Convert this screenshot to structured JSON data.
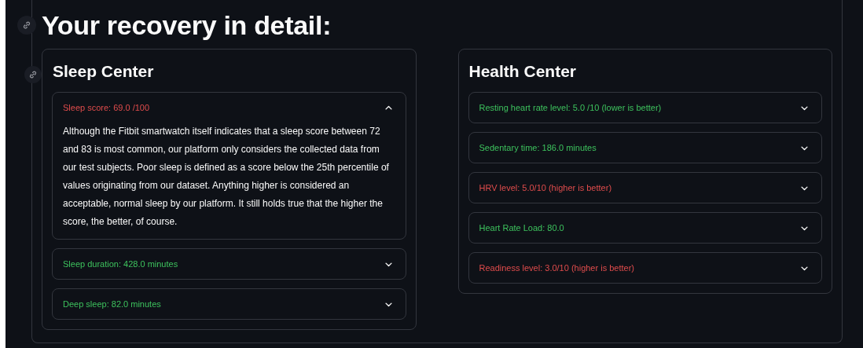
{
  "heading": "Your recovery in detail:",
  "cards": [
    {
      "title": "Sleep Center",
      "expanders": [
        {
          "label": "Sleep score: 69.0 /100",
          "color": "#e04c4c",
          "expanded": true,
          "body": "Although the Fitbit smartwatch itself indicates that a sleep score between 72 and 83 is most common, our platform only considers the collected data from our test subjects. Poor sleep is defined as a score below the 25th percentile of values originating from our dataset. Anything higher is considered an acceptable, normal sleep by our platform. It still holds true that the higher the score, the better, of course."
        },
        {
          "label": "Sleep duration: 428.0 minutes",
          "color": "#3dc25d",
          "expanded": false
        },
        {
          "label": "Deep sleep: 82.0 minutes",
          "color": "#3dc25d",
          "expanded": false
        }
      ]
    },
    {
      "title": "Health Center",
      "expanders": [
        {
          "label": "Resting heart rate level: 5.0 /10 (lower is better)",
          "color": "#3dc25d",
          "expanded": false
        },
        {
          "label": "Sedentary time: 186.0 minutes",
          "color": "#3dc25d",
          "expanded": false
        },
        {
          "label": "HRV level: 5.0/10 (higher is better)",
          "color": "#e04c4c",
          "expanded": false
        },
        {
          "label": "Heart Rate Load: 80.0",
          "color": "#3dc25d",
          "expanded": false
        },
        {
          "label": "Readiness level: 3.0/10 (higher is better)",
          "color": "#e04c4c",
          "expanded": false
        }
      ]
    }
  ]
}
